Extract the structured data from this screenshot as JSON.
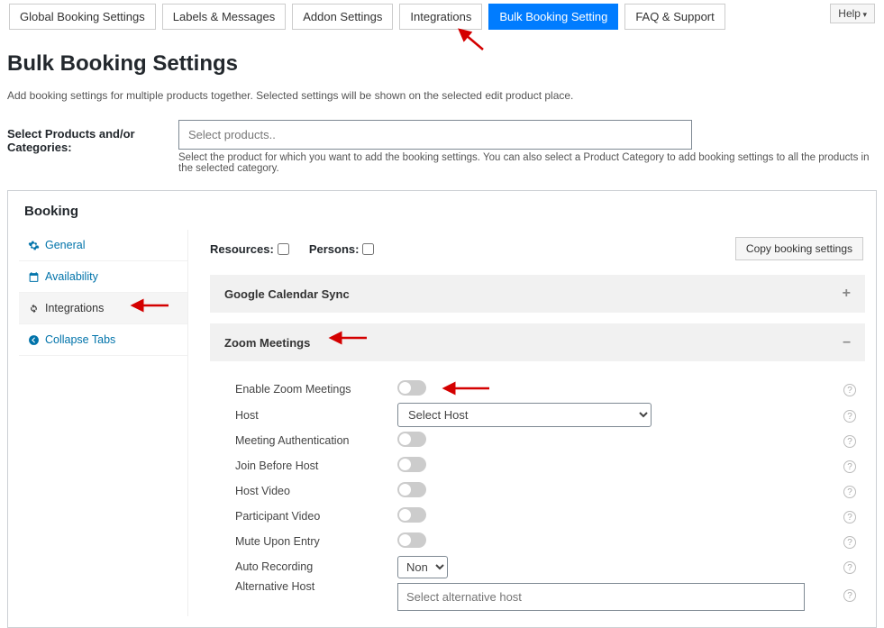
{
  "help": {
    "label": "Help"
  },
  "tabs": {
    "global": "Global Booking Settings",
    "labels": "Labels & Messages",
    "addon": "Addon Settings",
    "integrations": "Integrations",
    "bulk": "Bulk Booking Setting",
    "faq": "FAQ & Support"
  },
  "page": {
    "title": "Bulk Booking Settings",
    "desc": "Add booking settings for multiple products together. Selected settings will be shown on the selected edit product place."
  },
  "selprod": {
    "label": "Select Products and/or Categories:",
    "placeholder": "Select products..",
    "help": "Select the product for which you want to add the booking settings. You can also select a Product Category to add booking settings to all the products in the selected category."
  },
  "panel": {
    "booking": "Booking",
    "resources": "Resources:",
    "persons": "Persons:",
    "copy": "Copy booking settings"
  },
  "side": {
    "general": "General",
    "availability": "Availability",
    "integrations": "Integrations",
    "collapse": "Collapse Tabs"
  },
  "acc": {
    "gcal": "Google Calendar Sync",
    "zoom": "Zoom Meetings",
    "plus": "+",
    "minus": "–"
  },
  "zoom": {
    "enable": "Enable Zoom Meetings",
    "host": "Host",
    "host_ph": "Select Host",
    "auth": "Meeting Authentication",
    "join": "Join Before Host",
    "hostvideo": "Host Video",
    "partvideo": "Participant Video",
    "mute": "Mute Upon Entry",
    "autorec": "Auto Recording",
    "autorec_val": "None",
    "althost": "Alternative Host",
    "althost_ph": "Select alternative host"
  }
}
